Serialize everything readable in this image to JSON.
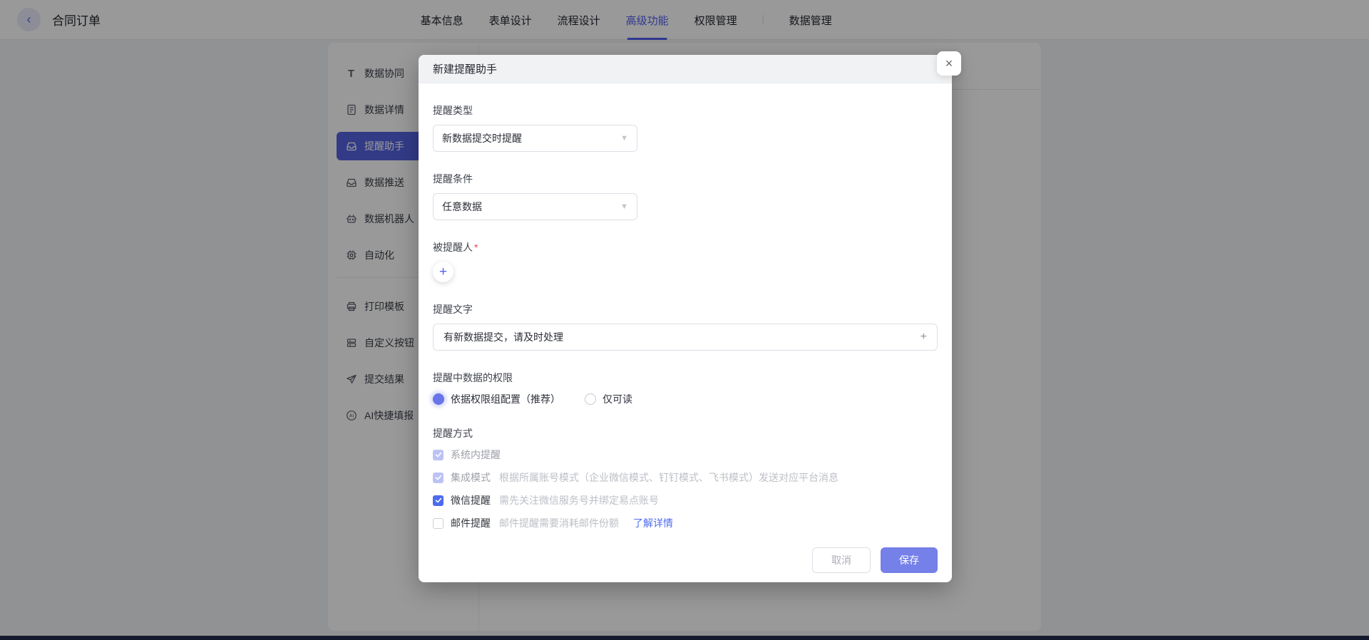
{
  "navbar": {
    "title": "合同订单",
    "tabs": [
      {
        "label": "基本信息",
        "active": false
      },
      {
        "label": "表单设计",
        "active": false
      },
      {
        "label": "流程设计",
        "active": false
      },
      {
        "label": "高级功能",
        "active": true
      },
      {
        "label": "权限管理",
        "active": false
      },
      {
        "label": "数据管理",
        "active": false
      }
    ]
  },
  "sidebar": {
    "items": [
      {
        "label": "数据协同",
        "icon": "text-icon",
        "selected": false
      },
      {
        "label": "数据详情",
        "icon": "document-icon",
        "selected": false
      },
      {
        "label": "提醒助手",
        "icon": "inbox-icon",
        "selected": true
      },
      {
        "label": "数据推送",
        "icon": "inbox-icon",
        "selected": false
      },
      {
        "label": "数据机器人",
        "icon": "robot-icon",
        "selected": false
      },
      {
        "label": "自动化",
        "icon": "chip-icon",
        "selected": false
      },
      {
        "label": "打印模板",
        "icon": "printer-icon",
        "selected": false
      },
      {
        "label": "自定义按钮",
        "icon": "stacked-cards-icon",
        "selected": false
      },
      {
        "label": "提交结果",
        "icon": "paper-plane-icon",
        "selected": false
      },
      {
        "label": "AI快捷填报",
        "icon": "ai-icon",
        "selected": false
      }
    ]
  },
  "modal": {
    "title": "新建提醒助手",
    "fields": {
      "reminder_type": {
        "label": "提醒类型",
        "value": "新数据提交时提醒"
      },
      "reminder_condition": {
        "label": "提醒条件",
        "value": "任意数据"
      },
      "reminded_person": {
        "label": "被提醒人",
        "required_mark": "*"
      },
      "reminder_text": {
        "label": "提醒文字",
        "value": "有新数据提交，请及时处理"
      },
      "data_permission": {
        "label": "提醒中数据的权限",
        "options": [
          {
            "label": "依据权限组配置（推荐）",
            "selected": true
          },
          {
            "label": "仅可读",
            "selected": false
          }
        ]
      },
      "reminder_methods": {
        "label": "提醒方式",
        "options": [
          {
            "label": "系统内提醒",
            "desc": "",
            "checked": true,
            "disabled": true
          },
          {
            "label": "集成模式",
            "desc": "根据所属账号模式（企业微信模式、钉钉模式、飞书模式）发送对应平台消息",
            "checked": true,
            "disabled": true
          },
          {
            "label": "微信提醒",
            "desc": "需先关注微信服务号并绑定易点账号",
            "checked": true,
            "disabled": false
          },
          {
            "label": "邮件提醒",
            "desc": "邮件提醒需要消耗邮件份额",
            "checked": false,
            "disabled": false,
            "link": "了解详情"
          }
        ]
      }
    },
    "footer": {
      "cancel_label": "取消",
      "save_label": "保存"
    }
  },
  "icons": {
    "back": "‹",
    "close": "×",
    "caret": "▼",
    "add_person": "+",
    "input_plus": "+",
    "ai_glyph": "AI",
    "text_glyph": "T"
  },
  "colors": {
    "brand_blue": "#4f5ef0",
    "save_button": "#7580e8",
    "checkbox_checked": "#4d6bef",
    "checkbox_disabled": "#bcc3f4",
    "radio_selected": "#6874e8",
    "link": "#4e6bf0",
    "required_red": "#e5484d",
    "selected_sidebar_bg": "#5663e2",
    "bottom_strip": "#222c4e"
  }
}
